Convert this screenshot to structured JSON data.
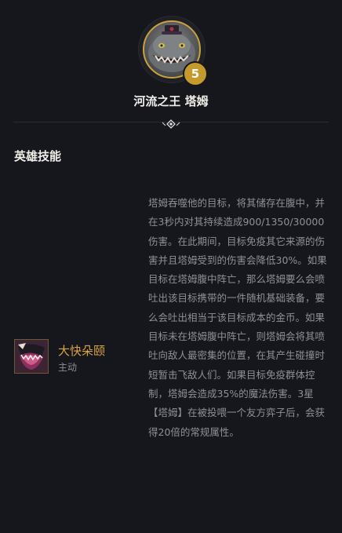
{
  "champion": {
    "name": "河流之王 塔姆",
    "level": "5"
  },
  "section": {
    "title": "英雄技能"
  },
  "skill": {
    "name": "大快朵颐",
    "type": "主动",
    "description": "塔姆吞噬他的目标，将其储存在腹中，并在3秒内对其持续造成900/1350/30000伤害。在此期间，目标免疫其它来源的伤害并且塔姆受到的伤害会降低30%。如果目标在塔姆腹中阵亡，那么塔姆要么会喷吐出该目标携带的一件随机基础装备，要么会吐出相当于该目标成本的金币。如果目标未在塔姆腹中阵亡，则塔姆会将其喷吐向敌人最密集的位置，在其产生碰撞时短暂击飞敌人们。如果目标免疫群体控制，塔姆会造成35%的魔法伤害。3星【塔姆】在被投喂一个友方弈子后，会获得20倍的常规属性。"
  },
  "colors": {
    "background": "#16171c",
    "gold_accent": "#c9a23a",
    "skill_name": "#d9a441",
    "body_text": "#8f9097"
  },
  "icons": [
    "tahm-kench-portrait-icon",
    "divider-ornament-icon",
    "skill-devour-icon"
  ]
}
